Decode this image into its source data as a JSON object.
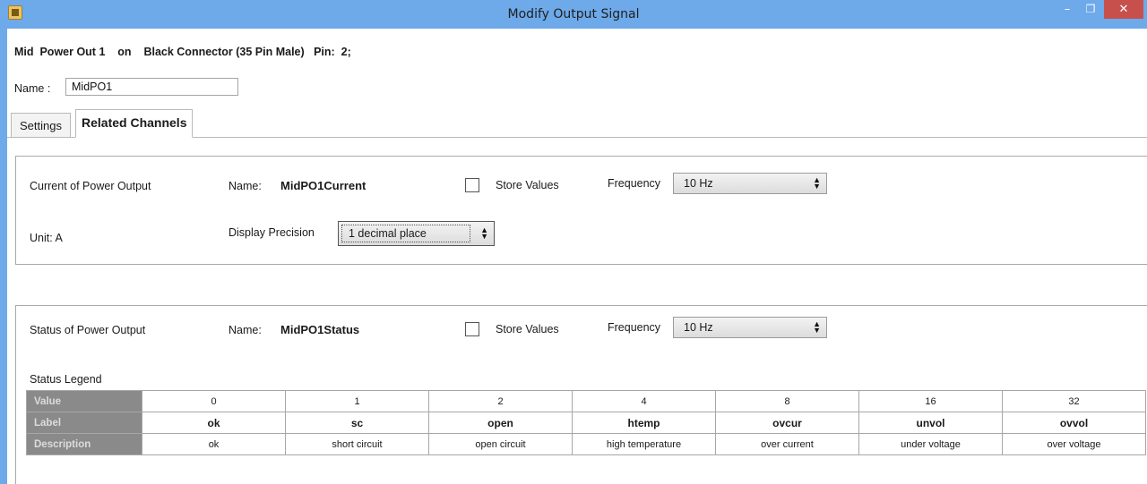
{
  "window": {
    "title": "Modify Output Signal",
    "min_glyph": "–",
    "max_glyph": "❐",
    "close_glyph": "✕"
  },
  "signal": {
    "summary": "Mid  Power Out 1    on    Black Connector (35 Pin Male)   Pin:  2;",
    "name_label": "Name :",
    "name_value": "MidPO1"
  },
  "tabs": [
    {
      "label": "Settings",
      "active": false
    },
    {
      "label": "Related Channels",
      "active": true
    }
  ],
  "channels": [
    {
      "title": "Current of Power Output",
      "name_label": "Name:",
      "name_value": "MidPO1Current",
      "store_values_label": "Store Values",
      "store_values_checked": false,
      "frequency_label": "Frequency",
      "frequency_value": "10 Hz",
      "unit_text": "Unit:  A",
      "precision_label": "Display Precision",
      "precision_value": "1 decimal place"
    },
    {
      "title": "Status of Power Output",
      "name_label": "Name:",
      "name_value": "MidPO1Status",
      "store_values_label": "Store Values",
      "store_values_checked": false,
      "frequency_label": "Frequency",
      "frequency_value": "10 Hz",
      "legend_title": "Status Legend"
    }
  ],
  "status_legend": {
    "row_headers": [
      "Value",
      "Label",
      "Description"
    ],
    "values": [
      "0",
      "1",
      "2",
      "4",
      "8",
      "16",
      "32"
    ],
    "labels": [
      "ok",
      "sc",
      "open",
      "htemp",
      "ovcur",
      "unvol",
      "ovvol"
    ],
    "descriptions": [
      "ok",
      "short circuit",
      "open circuit",
      "high temperature",
      "over current",
      "under voltage",
      "over voltage"
    ]
  },
  "icons": {
    "app": "app-icon",
    "dropdown": "up-down-arrows-icon"
  },
  "colors": {
    "titlebar": "#6ea9ea",
    "close_button": "#c7504d",
    "legend_header": "#8a8a8a"
  }
}
